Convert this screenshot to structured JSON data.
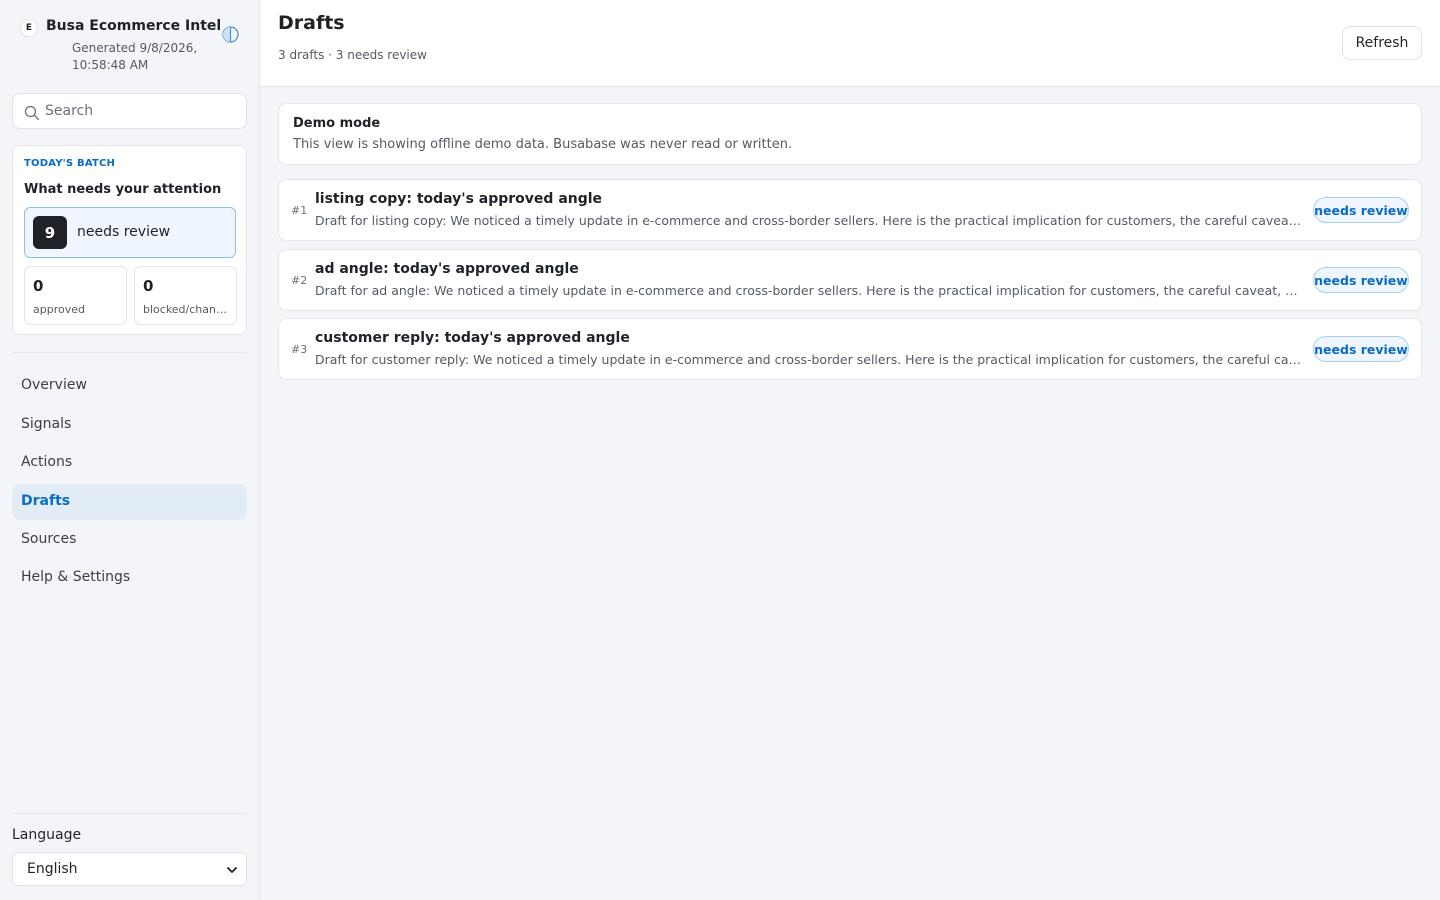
{
  "brand": {
    "badge": "E",
    "title": "Busa Ecommerce Intel",
    "generated": "Generated 9/8/2026, 10:58:48 AM"
  },
  "search": {
    "placeholder": "Search",
    "value": ""
  },
  "batch": {
    "kicker": "TODAY'S BATCH",
    "title": "What needs your attention",
    "needs_review": {
      "count": "9",
      "label": "needs review"
    },
    "approved": {
      "count": "0",
      "label": "approved"
    },
    "blocked": {
      "count": "0",
      "label": "blocked/changes requested"
    }
  },
  "nav": {
    "items": [
      {
        "label": "Overview",
        "active": false
      },
      {
        "label": "Signals",
        "active": false
      },
      {
        "label": "Actions",
        "active": false
      },
      {
        "label": "Drafts",
        "active": true
      },
      {
        "label": "Sources",
        "active": false
      },
      {
        "label": "Help & Settings",
        "active": false
      }
    ]
  },
  "language": {
    "label": "Language",
    "selected": "English"
  },
  "header": {
    "title": "Drafts",
    "subtitle": "3 drafts · 3 needs review",
    "refresh_label": "Refresh"
  },
  "demo": {
    "title": "Demo mode",
    "text": "This view is showing offline demo data. Busabase was never read or written."
  },
  "drafts": [
    {
      "num": "#1",
      "title": "listing copy: today's approved angle",
      "description": "Draft for listing copy: We noticed a timely update in e-commerce and cross-border sellers. Here is the practical implication for customers, the careful caveat, and one simple next step.",
      "status": "needs review"
    },
    {
      "num": "#2",
      "title": "ad angle: today's approved angle",
      "description": "Draft for ad angle: We noticed a timely update in e-commerce and cross-border sellers. Here is the practical implication for customers, the careful caveat, and one simple next step.",
      "status": "needs review"
    },
    {
      "num": "#3",
      "title": "customer reply: today's approved angle",
      "description": "Draft for customer reply: We noticed a timely update in e-commerce and cross-border sellers. Here is the practical implication for customers, the careful caveat, and one simple next step.",
      "status": "needs review"
    }
  ],
  "colors": {
    "accent": "#0a6cc2",
    "active_nav_bg": "#e2ecf7",
    "badge_bg": "#eff6ff",
    "page_bg": "#f3f5f8"
  },
  "icons": {
    "theme": "half-circle-icon",
    "search": "search-icon",
    "chevron": "chevron-down-icon"
  }
}
